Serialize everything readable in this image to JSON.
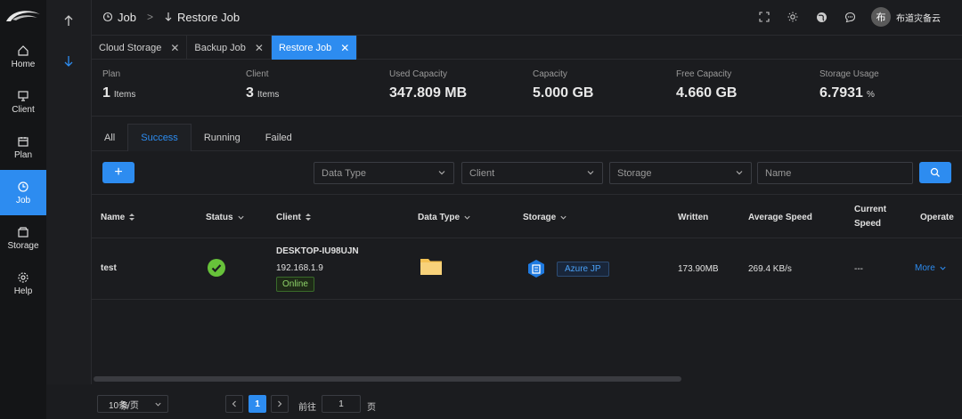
{
  "nav": {
    "items": [
      {
        "label": "Home",
        "icon": "home-icon"
      },
      {
        "label": "Client",
        "icon": "monitor-icon"
      },
      {
        "label": "Plan",
        "icon": "calendar-icon"
      },
      {
        "label": "Job",
        "icon": "clock-icon"
      },
      {
        "label": "Storage",
        "icon": "storage-icon"
      },
      {
        "label": "Help",
        "icon": "gear-icon"
      }
    ]
  },
  "header": {
    "breadcrumb": [
      "Job",
      "Restore Job"
    ],
    "user_name": "布道灾备云",
    "avatar_initial": "布"
  },
  "tabs": [
    {
      "label": "Cloud Storage"
    },
    {
      "label": "Backup Job"
    },
    {
      "label": "Restore Job",
      "active": true
    }
  ],
  "stats": [
    {
      "label": "Plan",
      "value": "1",
      "unit": "Items"
    },
    {
      "label": "Client",
      "value": "3",
      "unit": "Items"
    },
    {
      "label": "Used Capacity",
      "value": "347.809 MB",
      "unit": ""
    },
    {
      "label": "Capacity",
      "value": "5.000 GB",
      "unit": ""
    },
    {
      "label": "Free Capacity",
      "value": "4.660 GB",
      "unit": ""
    },
    {
      "label": "Storage Usage",
      "value": "6.7931",
      "unit": "%"
    }
  ],
  "filter_tabs": [
    "All",
    "Success",
    "Running",
    "Failed"
  ],
  "filters": {
    "data_type_placeholder": "Data Type",
    "client_placeholder": "Client",
    "storage_placeholder": "Storage",
    "name_placeholder": "Name",
    "add_label": "+"
  },
  "table": {
    "columns": [
      "Name",
      "Status",
      "Client",
      "Data Type",
      "Storage",
      "Written",
      "Average Speed",
      "Current Speed",
      "Operate"
    ],
    "rows": [
      {
        "name": "test",
        "client_name": "DESKTOP-IU98UJN",
        "client_ip": "192.168.1.9",
        "client_status": "Online",
        "storage": "Azure JP",
        "written": "173.90MB",
        "avg_speed": "269.4 KB/s",
        "current_speed": "---",
        "operate": "More"
      }
    ]
  },
  "pagination": {
    "total_suffix": "条",
    "page_size": "10条/页",
    "current_page": "1",
    "jump_prefix": "前往",
    "jump_value": "1",
    "jump_suffix": "页"
  },
  "colors": {
    "accent": "#2d8cf0",
    "success": "#67c23a"
  }
}
